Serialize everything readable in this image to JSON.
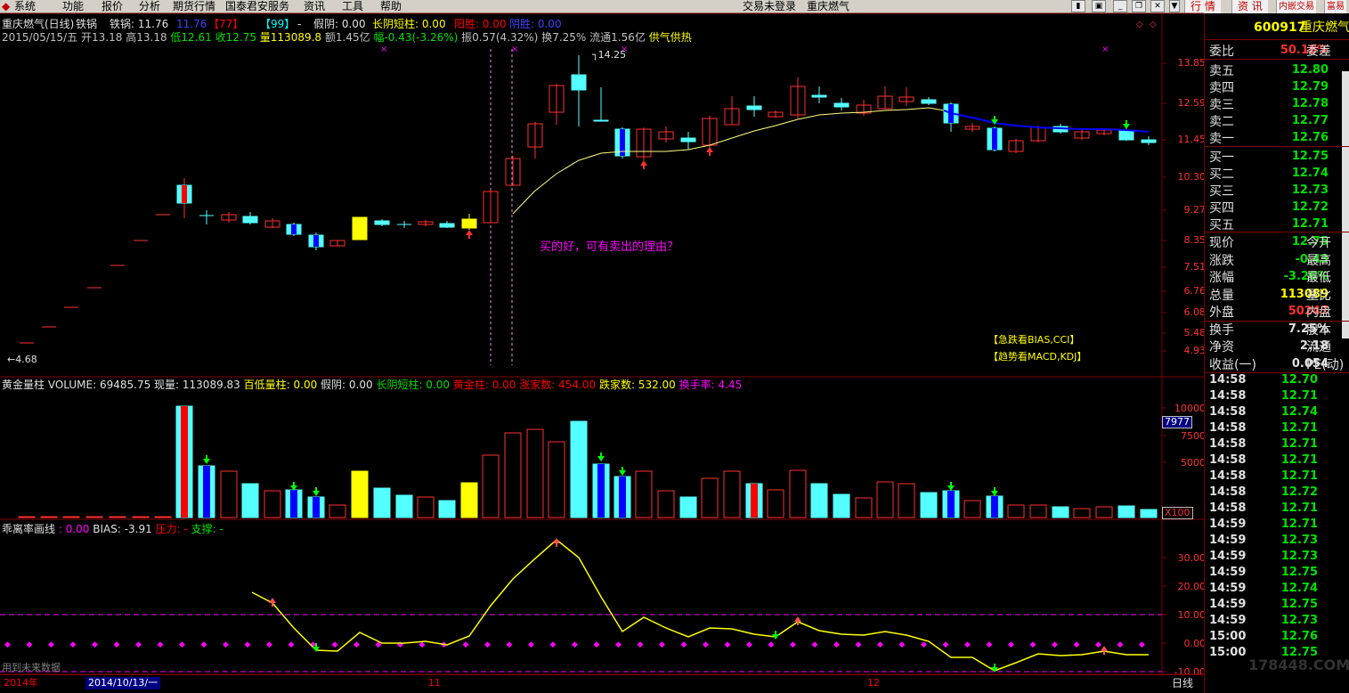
{
  "menubar": {
    "items": [
      "系统",
      "功能",
      "报价",
      "分析",
      "期货行情",
      "国泰君安服务",
      "资讯",
      "工具",
      "帮助"
    ],
    "login_status": "交易未登录",
    "current_stock": "重庆燃气",
    "buttons": [
      "行 情",
      "资 讯",
      "内嵌交易",
      "富易"
    ]
  },
  "header": {
    "title": "重庆燃气(日线)",
    "indicator": "铁锅",
    "indicator_value_label": "铁锅: 11.76",
    "v1": "11.76",
    "v2": "77",
    "v3": "99",
    "v4": "-",
    "fake_yin": "假阴: 0.00",
    "long_yin": "长阴短柱: 0.00",
    "yang_win": "阳胜: 0.00",
    "yin_win": "阴胜: 0.00"
  },
  "quote_line": {
    "date": "2015/05/15/五",
    "open": "开13.18",
    "high": "高13.18",
    "low": "低12.61",
    "close": "收12.75",
    "volume": "量113089.8",
    "amount": "额1.45亿",
    "change": "幅-0.43(-3.26%)",
    "amplitude": "振0.57(4.32%)",
    "turnover": "换7.25%",
    "float": "流通1.56亿",
    "tag": "供气供热"
  },
  "main_chart": {
    "price_ticks": [
      "13.85",
      "12.59",
      "11.45",
      "10.30",
      "9.27",
      "8.35",
      "7.51",
      "6.76",
      "6.08",
      "5.48",
      "4.93"
    ],
    "high_label": "14.25",
    "low_label": "4.68",
    "annotation": "买的好，可有卖出的理由？",
    "hints": [
      "【急跌看BIAS,CCI】",
      "【趋势看MACD,KDJ】"
    ]
  },
  "volume_panel": {
    "title": "黄金量柱",
    "volume": "VOLUME: 69485.75",
    "current": "现量: 113089.83",
    "low_vol": "百低量柱: 0.00",
    "fake_yin": "假阴: 0.00",
    "long_yin": "长阴短柱: 0.00",
    "gold": "黄金柱: 0.00",
    "up_count": "涨家数: 454.00",
    "down_count": "跌家数: 532.00",
    "turnover": "换手率: 4.45",
    "ticks": [
      "10000",
      "7500",
      "5000"
    ],
    "badge": "7977",
    "unit": "X100"
  },
  "bias_panel": {
    "title": "乖离率画线",
    "v0": ": 0.00",
    "bias": "BIAS: -3.91",
    "pressure": "压力: -",
    "support": "支撑: -",
    "ticks": [
      "30.00",
      "20.00",
      "10.00",
      "0.00",
      "-10.00"
    ],
    "footnote": "用到未来数据"
  },
  "xaxis": {
    "year_label": "2014年",
    "date_box": "2014/10/13/一",
    "month_11": "11",
    "month_12": "12",
    "period": "日线"
  },
  "right_panel": {
    "code": "600917",
    "name": "重庆燃气",
    "weibi_label": "委比",
    "weibi": "50.18%",
    "weicha_label": "委差",
    "asks": [
      {
        "label": "卖五",
        "price": "12.80"
      },
      {
        "label": "卖四",
        "price": "12.79"
      },
      {
        "label": "卖三",
        "price": "12.78"
      },
      {
        "label": "卖二",
        "price": "12.77"
      },
      {
        "label": "卖一",
        "price": "12.76"
      }
    ],
    "bids": [
      {
        "label": "买一",
        "price": "12.75"
      },
      {
        "label": "买二",
        "price": "12.74"
      },
      {
        "label": "买三",
        "price": "12.73"
      },
      {
        "label": "买四",
        "price": "12.72"
      },
      {
        "label": "买五",
        "price": "12.71"
      }
    ],
    "stats": [
      {
        "label": "现价",
        "value": "12.75",
        "color": "#00e000",
        "extra": "今开"
      },
      {
        "label": "涨跌",
        "value": "-0.43",
        "color": "#00e000",
        "extra": "最高"
      },
      {
        "label": "涨幅",
        "value": "-3.26%",
        "color": "#00e000",
        "extra": "最低"
      },
      {
        "label": "总量",
        "value": "113089",
        "color": "#ffff00",
        "extra": "量比"
      },
      {
        "label": "外盘",
        "value": "50247",
        "color": "#ff3030",
        "extra": "内盘"
      },
      {
        "label": "换手",
        "value": "7.25%",
        "color": "#e0e0e0",
        "extra": "股本"
      },
      {
        "label": "净资",
        "value": "2.18",
        "color": "#e0e0e0",
        "extra": "流通"
      },
      {
        "label": "收益(一)",
        "value": "0.054",
        "color": "#e0e0e0",
        "extra": "PE(动)"
      }
    ],
    "ticks": [
      {
        "time": "14:58",
        "price": "12.70"
      },
      {
        "time": "14:58",
        "price": "12.71"
      },
      {
        "time": "14:58",
        "price": "12.74"
      },
      {
        "time": "14:58",
        "price": "12.71"
      },
      {
        "time": "14:58",
        "price": "12.71"
      },
      {
        "time": "14:58",
        "price": "12.71"
      },
      {
        "time": "14:58",
        "price": "12.71"
      },
      {
        "time": "14:58",
        "price": "12.72"
      },
      {
        "time": "14:58",
        "price": "12.71"
      },
      {
        "time": "14:59",
        "price": "12.71"
      },
      {
        "time": "14:59",
        "price": "12.73"
      },
      {
        "time": "14:59",
        "price": "12.73"
      },
      {
        "time": "14:59",
        "price": "12.75"
      },
      {
        "time": "14:59",
        "price": "12.74"
      },
      {
        "time": "14:59",
        "price": "12.75"
      },
      {
        "time": "14:59",
        "price": "12.73"
      },
      {
        "time": "15:00",
        "price": "12.76"
      },
      {
        "time": "15:00",
        "price": "12.75"
      }
    ]
  },
  "watermark": "178448.COM"
}
